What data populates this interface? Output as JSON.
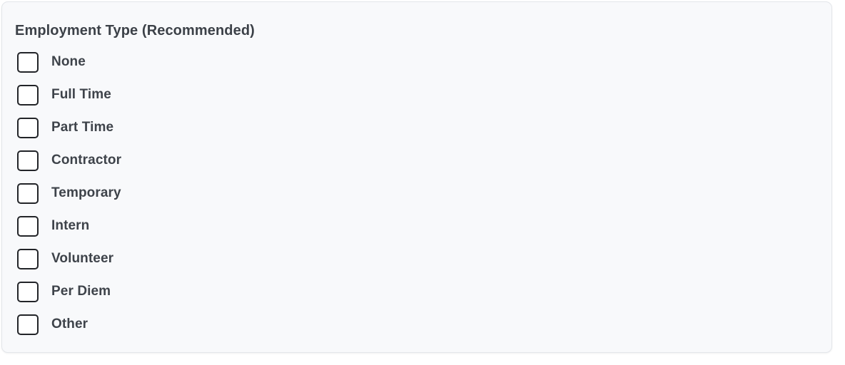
{
  "panel": {
    "background_color": "#f8f9fb",
    "border_color": "#e3e6ea"
  },
  "group": {
    "title": "Employment Type (Recommended)",
    "options": [
      {
        "label": "None",
        "checked": false
      },
      {
        "label": "Full Time",
        "checked": false
      },
      {
        "label": "Part Time",
        "checked": false
      },
      {
        "label": "Contractor",
        "checked": false
      },
      {
        "label": "Temporary",
        "checked": false
      },
      {
        "label": "Intern",
        "checked": false
      },
      {
        "label": "Volunteer",
        "checked": false
      },
      {
        "label": "Per Diem",
        "checked": false
      },
      {
        "label": "Other",
        "checked": false
      }
    ]
  }
}
